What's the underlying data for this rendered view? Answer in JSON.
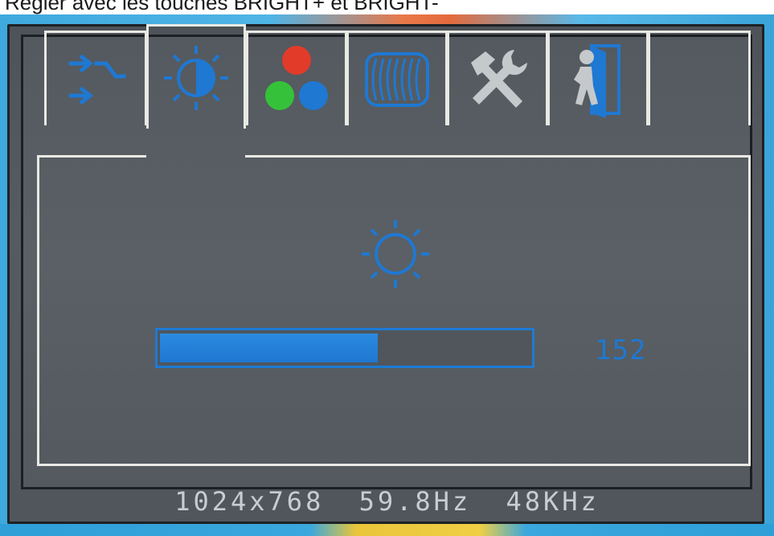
{
  "header_text": "Régler avec les touches BRIGHT+ et BRIGHT-",
  "tabs": [
    {
      "name": "input-source-icon",
      "active": false
    },
    {
      "name": "brightness-contrast-icon",
      "active": true
    },
    {
      "name": "color-icon",
      "active": false
    },
    {
      "name": "image-geometry-icon",
      "active": false
    },
    {
      "name": "tools-icon",
      "active": false
    },
    {
      "name": "exit-icon",
      "active": false
    },
    {
      "name": "empty-tab",
      "active": false
    }
  ],
  "brightness": {
    "icon": "sun-icon",
    "value_label": "152",
    "level_fraction": 0.59
  },
  "status": {
    "resolution": "1024x768",
    "vertical_freq": "59.8Hz",
    "horizontal_freq": "48KHz"
  },
  "colors": {
    "accent": "#1f78d2",
    "tab_border": "#e9e9e4",
    "panel": "#555b60"
  }
}
